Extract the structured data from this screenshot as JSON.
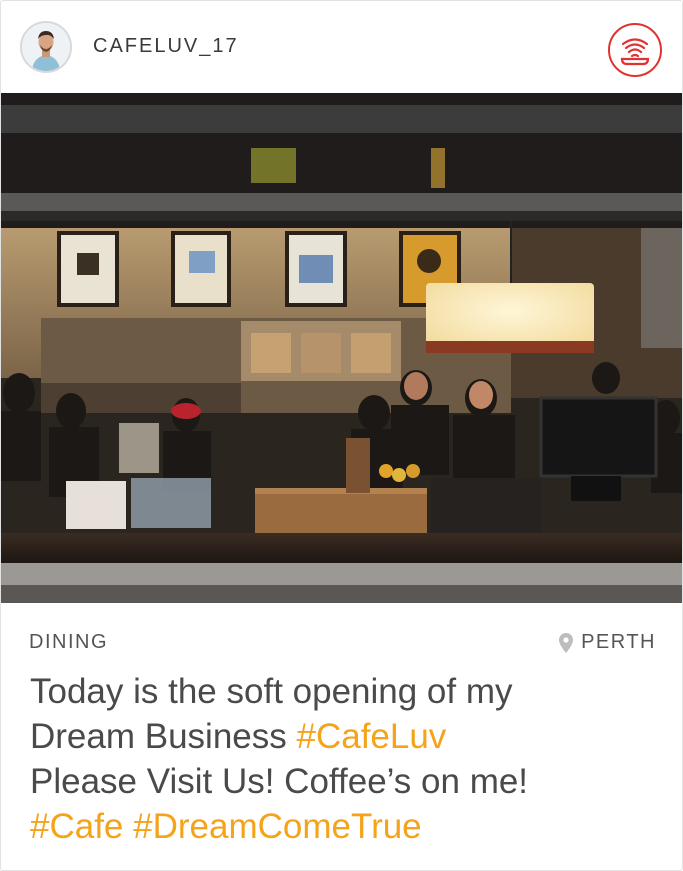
{
  "post": {
    "username": "CAFELUV_17",
    "category": "DINING",
    "location": "PERTH",
    "caption": {
      "line1": "Today is the soft opening of my",
      "line2_text": "Dream Business ",
      "line2_tag": "#CafeLuv",
      "line3": "Please Visit Us! Coffee’s on me!",
      "line4_tag1": "#Cafe",
      "line4_space": " ",
      "line4_tag2": "#DreamComeTrue"
    }
  },
  "icons": {
    "feed": "rss-feed-icon",
    "location": "map-pin-icon",
    "avatar": "user-avatar"
  },
  "colors": {
    "accent": "#f5a31a",
    "feed_red": "#e0332f",
    "text": "#4a4a4a",
    "meta": "#555555"
  }
}
